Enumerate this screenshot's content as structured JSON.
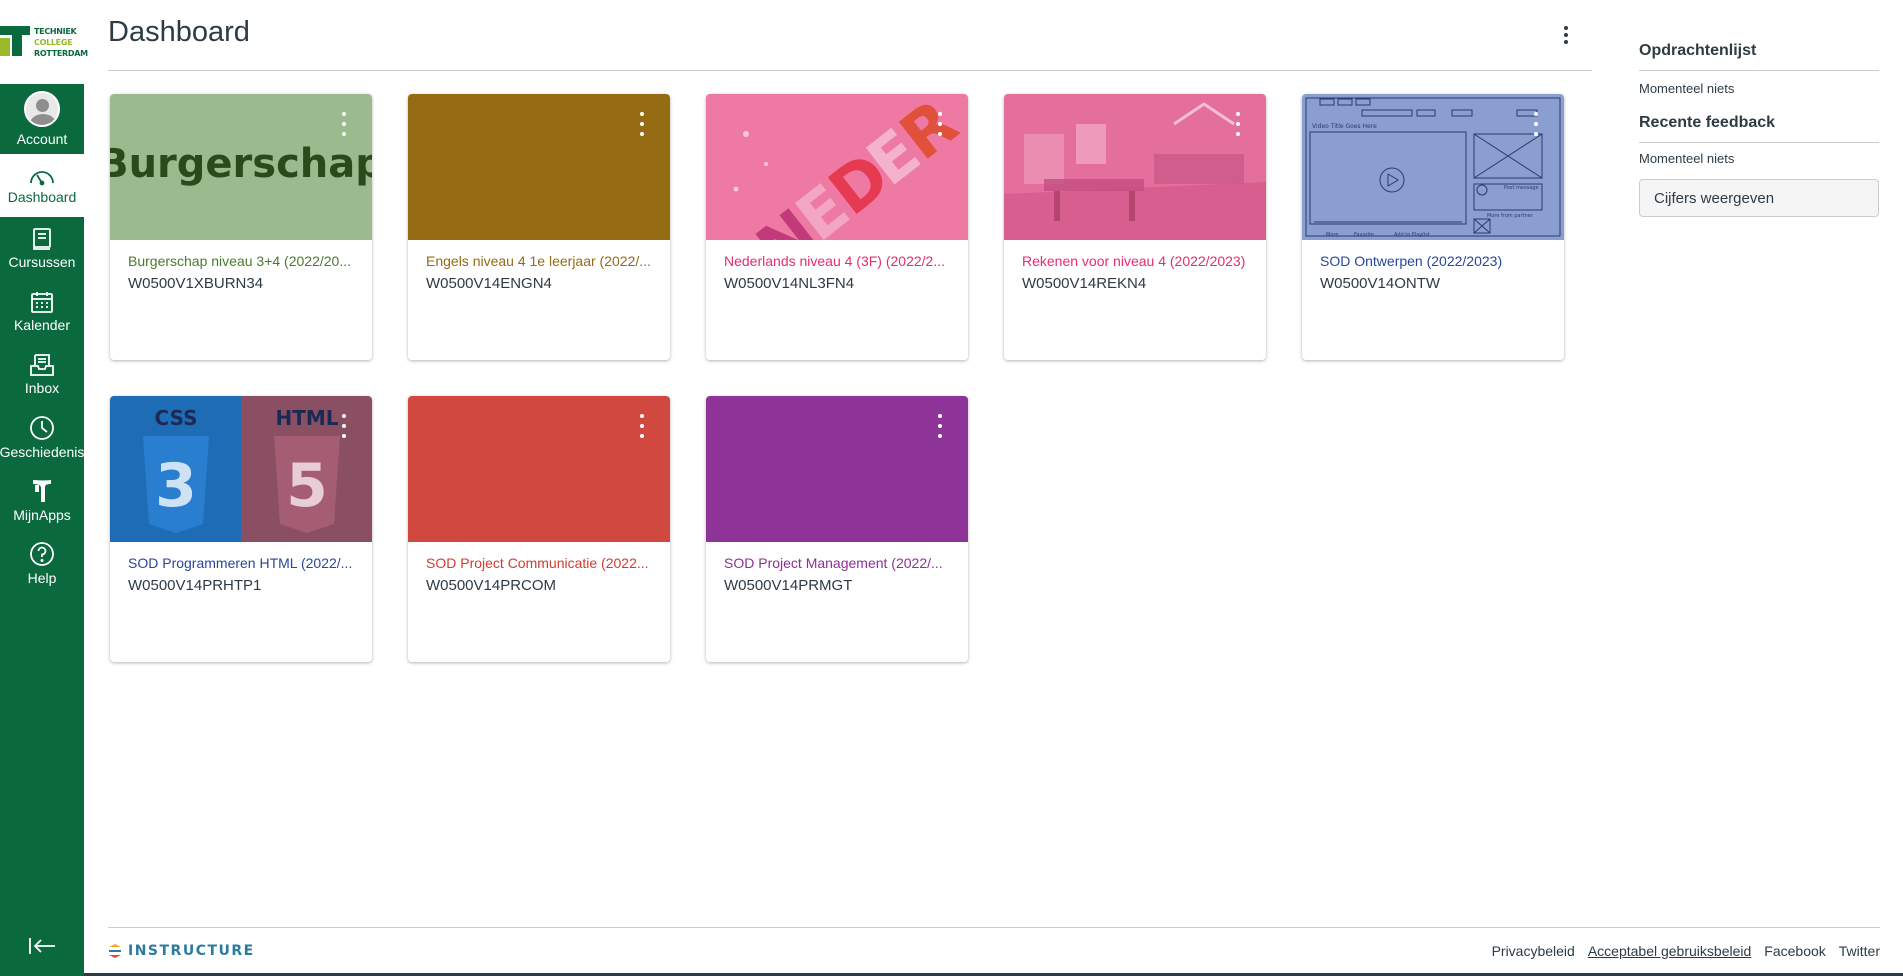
{
  "brand": {
    "logo_lines": [
      "TECHNIEK",
      "COLLEGE",
      "ROTTERDAM"
    ],
    "nav_color": "#0a6a3e",
    "accent_color": "#9ab82a"
  },
  "nav": {
    "items": [
      {
        "label": "Account",
        "icon": "user-avatar-icon"
      },
      {
        "label": "Dashboard",
        "icon": "dashboard-gauge-icon"
      },
      {
        "label": "Cursussen",
        "icon": "book-icon"
      },
      {
        "label": "Kalender",
        "icon": "calendar-icon"
      },
      {
        "label": "Inbox",
        "icon": "inbox-icon"
      },
      {
        "label": "Geschiedenis",
        "icon": "clock-icon"
      },
      {
        "label": "MijnApps",
        "icon": "apps-icon"
      },
      {
        "label": "Help",
        "icon": "help-icon"
      }
    ],
    "active": "Dashboard",
    "collapse_icon": "collapse-arrow-icon"
  },
  "header": {
    "title": "Dashboard",
    "menu_icon": "kebab-menu-icon"
  },
  "courses": [
    {
      "title": "Burgerschap niveau 3+4 (2022/20...",
      "code": "W0500V1XBURN34",
      "color": "#4a7a2e",
      "hero_color": "#9bba8e",
      "hero_text": "Burgerschap"
    },
    {
      "title": "Engels niveau 4 1e leerjaar (2022/...",
      "code": "W0500V14ENGN4",
      "color": "#956b14",
      "hero_color": "#956b14"
    },
    {
      "title": "Nederlands niveau 4 (3F) (2022/2...",
      "code": "W0500V14NL3FN4",
      "color": "#e62b73",
      "hero_color": "#ee7aa3"
    },
    {
      "title": "Rekenen voor niveau 4 (2022/2023)",
      "code": "W0500V14REKN4",
      "color": "#e62b73",
      "hero_color": "#e46e9c"
    },
    {
      "title": "SOD Ontwerpen (2022/2023)",
      "code": "W0500V14ONTW",
      "color": "#27479a",
      "hero_color": "#8a9fd0",
      "hero_mock": {
        "text1": "Video Title Goes Here",
        "text2": "Post message",
        "text3": "More from partner",
        "text4": "Add to Playlist",
        "text5": "Favorite",
        "text6": "More"
      }
    },
    {
      "title": "SOD Programmeren HTML (2022/...",
      "code": "W0500V14PRHTP1",
      "color": "#27479a",
      "hero_color": "#1f6cb6",
      "hero_labels": [
        "CSS",
        "HTML",
        "3",
        "5"
      ]
    },
    {
      "title": "SOD Project Communicatie (2022...",
      "code": "W0500V14PRCOM",
      "color": "#d23b31",
      "hero_color": "#d14840"
    },
    {
      "title": "SOD Project Management (2022/...",
      "code": "W0500V14PRMGT",
      "color": "#8e2f95",
      "hero_color": "#8e3398"
    }
  ],
  "sidebar": {
    "todo_title": "Opdrachtenlijst",
    "todo_empty": "Momenteel niets",
    "feedback_title": "Recente feedback",
    "feedback_empty": "Momenteel niets",
    "grades_button": "Cijfers weergeven"
  },
  "footer": {
    "brand": "INSTRUCTURE",
    "links": [
      "Privacybeleid",
      "Acceptabel gebruiksbeleid",
      "Facebook",
      "Twitter"
    ]
  }
}
